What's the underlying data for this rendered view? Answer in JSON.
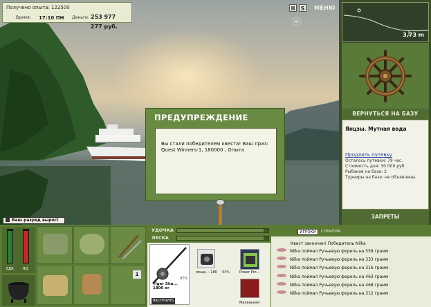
{
  "info": {
    "exp_text": "Получено опыта: 122500",
    "time_label": "Время:",
    "time_value": "17:10 ПН",
    "money_label": "Деньги:",
    "money_value": "253 977 277 руб."
  },
  "top": {
    "icon1": "II",
    "icon2": "S",
    "menu": "МЕНЮ"
  },
  "depth": {
    "value": "3,73 m"
  },
  "right": {
    "base_button": "ВЕРНУТЬСЯ НА БАЗУ",
    "location": "Янцзы. Мутная вода",
    "extend_link": "Продлить путевку",
    "lines": [
      "Осталось путевки: 79 час.",
      "Стоимость дня: 30 000 руб.",
      "Рыбаков на базе: 2",
      "Турниры на базе: не объявлены"
    ],
    "bans_button": "ЗАПРЕТЫ"
  },
  "dialog": {
    "title": "ПРЕДУПРЕЖДЕНИЕ",
    "text": "Вы стали победителем квеста! Ваш приз: Quest Winners-1, 180000 , Опыта"
  },
  "rank": {
    "text": "Ваш разряд вырос!"
  },
  "status": {
    "food_label": "ЕДА",
    "food_level": 0.95,
    "food_color": "#2e7d32",
    "health_label": "ЯД",
    "health_level": 0.95,
    "health_color": "#c62828"
  },
  "slot_number": "1",
  "tackle": {
    "rod_label": "УДОЧКА",
    "line_label": "ЛЕСКА",
    "rod_level": 0.95,
    "line_level": 0.95,
    "rod_pct": "97%",
    "reel_pct": "94%",
    "reel_caption": "мощн. : 180",
    "bait_caption": "Power Pro...",
    "rod_name_line1": "Tiger Sha...",
    "rod_name_line2": "1800 кг",
    "setup_button": "НАСТРОИТЬ",
    "small_caption": "Маленькая"
  },
  "log": {
    "tab_players": "ИГРОКИ",
    "tab_events": "СОБЫТИЯ",
    "header": "Квест закончен! Победитель Nilka",
    "rows": [
      "Nilka поймал Ручьевую форель на 558 грамм",
      "Nilka поймал Ручьевую форель на 333 грамм",
      "Nilka поймал Ручьевую форель на 316 грамм",
      "Nilka поймал Ручьевую форель на 463 грамм",
      "Nilka поймал Ручьевую форель на 468 грамм",
      "Nilka поймал Ручьевую форель на 312 грамм"
    ]
  }
}
